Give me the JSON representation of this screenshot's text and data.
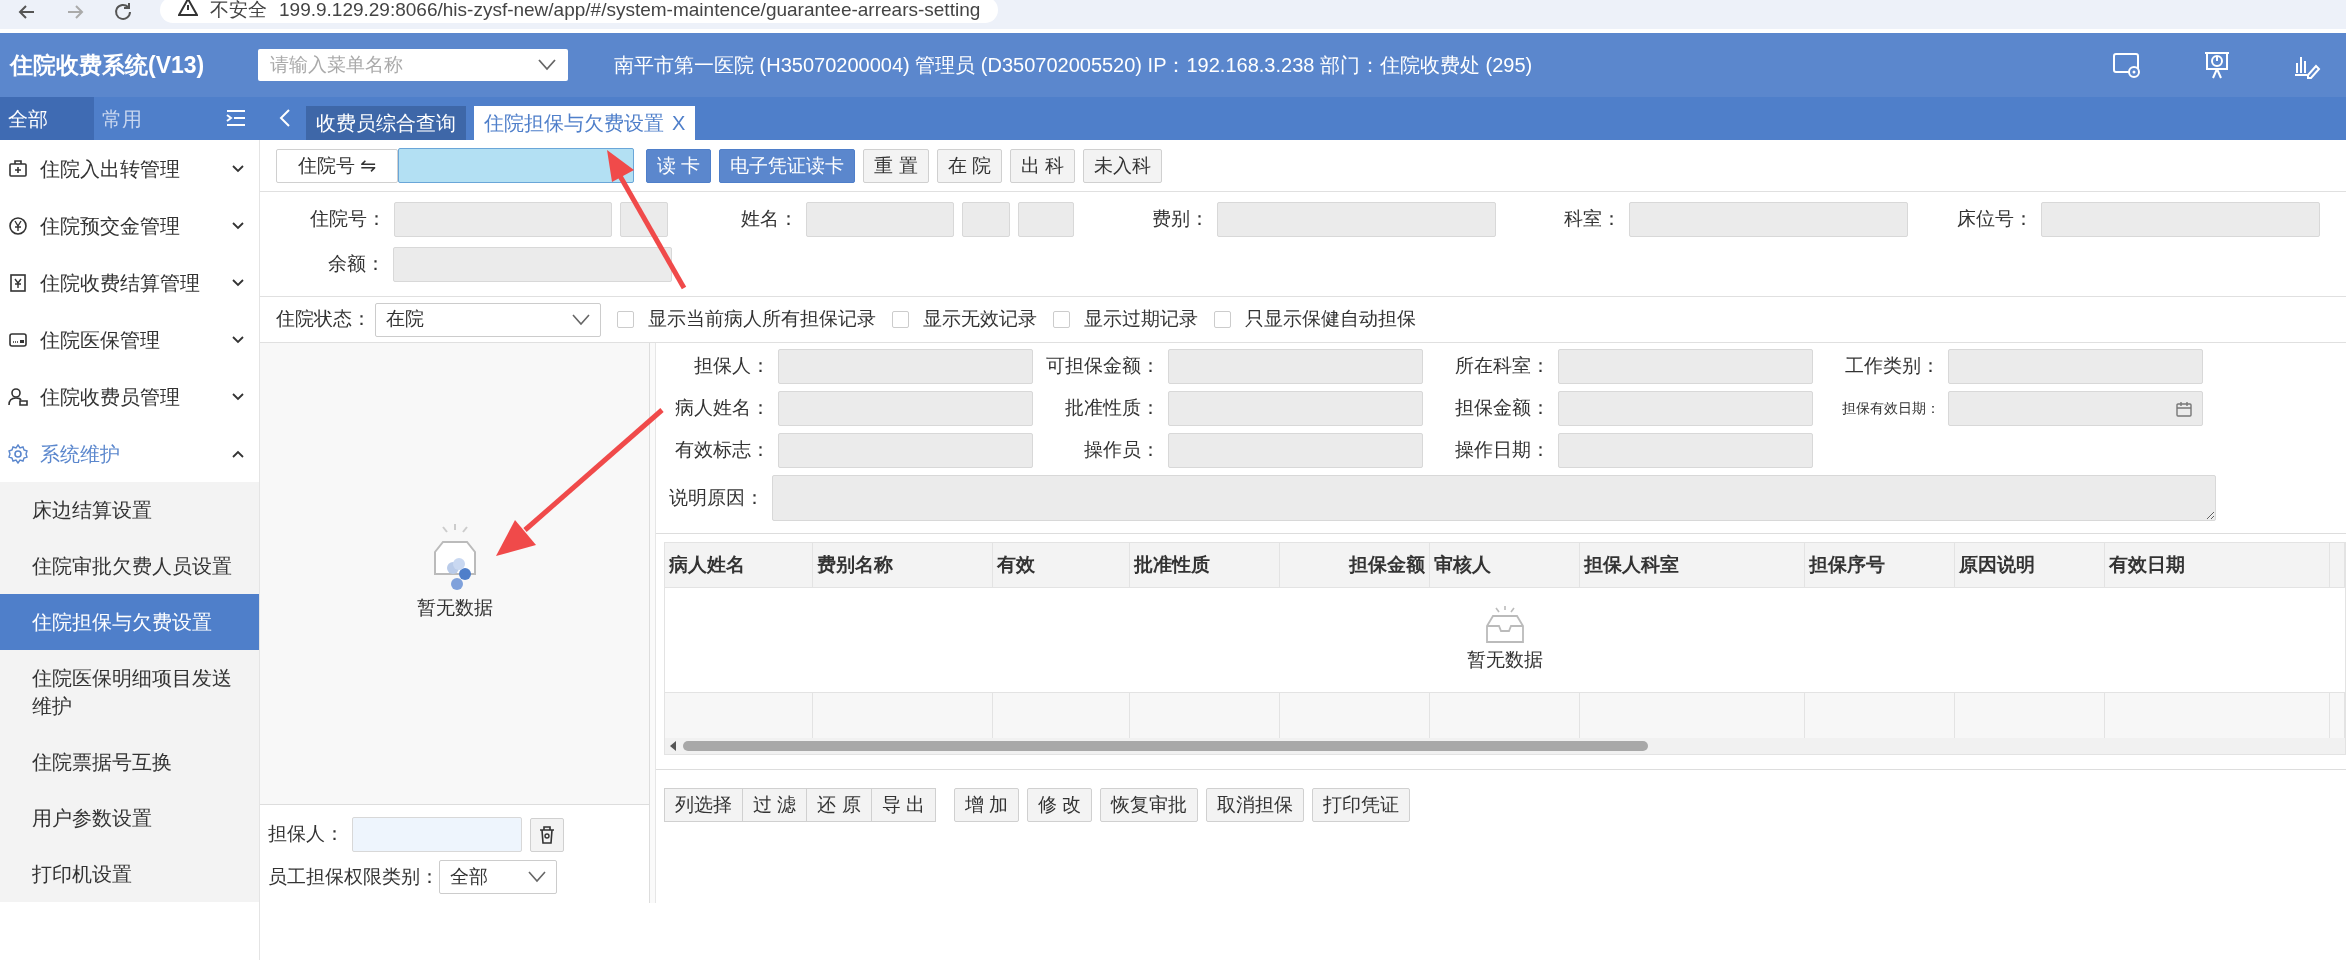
{
  "browser": {
    "security_label": "不安全",
    "url": "199.9.129.29:8066/his-zysf-new/app/#/system-maintence/guarantee-arrears-setting"
  },
  "header": {
    "title": "住院收费系统(V13)",
    "menu_search": {
      "placeholder": "请输入菜单名称"
    },
    "info": "南平市第一医院 (H35070200004) 管理员 (D350702005520) IP：192.168.3.238 部门：住院收费处 (295)"
  },
  "sidebar": {
    "tabs": [
      {
        "label": "全部",
        "selected": true
      },
      {
        "label": "常用",
        "selected": false
      }
    ],
    "items": [
      {
        "label": "住院入出转管理",
        "expanded": false
      },
      {
        "label": "住院预交金管理",
        "expanded": false
      },
      {
        "label": "住院收费结算管理",
        "expanded": false
      },
      {
        "label": "住院医保管理",
        "expanded": false
      },
      {
        "label": "住院收费员管理",
        "expanded": false
      },
      {
        "label": "系统维护",
        "expanded": true,
        "children": [
          {
            "label": "床边结算设置",
            "selected": false
          },
          {
            "label": "住院审批欠费人员设置",
            "selected": false
          },
          {
            "label": "住院担保与欠费设置",
            "selected": true
          },
          {
            "label": "住院医保明细项目发送维护",
            "selected": false
          },
          {
            "label": "住院票据号互换",
            "selected": false
          },
          {
            "label": "用户参数设置",
            "selected": false
          },
          {
            "label": "打印机设置",
            "selected": false
          }
        ]
      }
    ]
  },
  "tabs": [
    {
      "label": "收费员综合查询",
      "selected": false
    },
    {
      "label": "住院担保与欠费设置",
      "selected": true,
      "close_label": "X"
    }
  ],
  "toolbar": {
    "mode_button": "住院号 ⇋",
    "buttons": [
      {
        "label": "读 卡",
        "kind": "primary"
      },
      {
        "label": "电子凭证读卡",
        "kind": "primary"
      },
      {
        "label": "重 置",
        "kind": "default"
      },
      {
        "label": "在 院",
        "kind": "default"
      },
      {
        "label": "出 科",
        "kind": "default"
      },
      {
        "label": "未入科",
        "kind": "default"
      }
    ]
  },
  "patient": {
    "fields": [
      {
        "label": "住院号：",
        "kind": "id"
      },
      {
        "label": "姓名：",
        "kind": "name"
      },
      {
        "label": "费别：",
        "kind": "plain"
      },
      {
        "label": "科室：",
        "kind": "plain"
      },
      {
        "label": "床位号：",
        "kind": "plain"
      },
      {
        "label": "余额：",
        "kind": "plain"
      }
    ]
  },
  "filter": {
    "label": "住院状态：",
    "value": "在院",
    "checkboxes": [
      {
        "label": "显示当前病人所有担保记录",
        "checked": false
      },
      {
        "label": "显示无效记录",
        "checked": false
      },
      {
        "label": "显示过期记录",
        "checked": false
      },
      {
        "label": "只显示保健自动担保",
        "checked": false
      }
    ]
  },
  "left_panel": {
    "empty_text": "暂无数据",
    "guarantor_label": "担保人：",
    "category_label": "员工担保权限类别：",
    "category_value": "全部"
  },
  "detail": {
    "fields": [
      {
        "label": "担保人：",
        "kind": "text"
      },
      {
        "label": "可担保金额：",
        "kind": "text"
      },
      {
        "label": "所在科室：",
        "kind": "text"
      },
      {
        "label": "工作类别：",
        "kind": "text"
      },
      {
        "label": "病人姓名：",
        "kind": "text"
      },
      {
        "label": "批准性质：",
        "kind": "text"
      },
      {
        "label": "担保金额：",
        "kind": "text"
      },
      {
        "label": "担保有效日期：",
        "kind": "date"
      },
      {
        "label": "有效标志：",
        "kind": "text"
      },
      {
        "label": "操作员：",
        "kind": "text"
      },
      {
        "label": "操作日期：",
        "kind": "text"
      },
      {
        "label": "说明原因：",
        "kind": "textarea"
      }
    ]
  },
  "table": {
    "columns": [
      {
        "label": "病人姓名"
      },
      {
        "label": "费别名称"
      },
      {
        "label": "有效"
      },
      {
        "label": "批准性质"
      },
      {
        "label": "担保金额"
      },
      {
        "label": "审核人"
      },
      {
        "label": "担保人科室"
      },
      {
        "label": "担保序号"
      },
      {
        "label": "原因说明"
      },
      {
        "label": "有效日期"
      }
    ],
    "empty_text": "暂无数据"
  },
  "actions": [
    {
      "label": "列选择",
      "kind": "joined"
    },
    {
      "label": "过 滤",
      "kind": "joined"
    },
    {
      "label": "还 原",
      "kind": "joined"
    },
    {
      "label": "导 出",
      "kind": "joined"
    },
    {
      "label": "增 加",
      "kind": "single"
    },
    {
      "label": "修 改",
      "kind": "single"
    },
    {
      "label": "恢复审批",
      "kind": "single"
    },
    {
      "label": "取消担保",
      "kind": "single"
    },
    {
      "label": "打印凭证",
      "kind": "single"
    }
  ]
}
